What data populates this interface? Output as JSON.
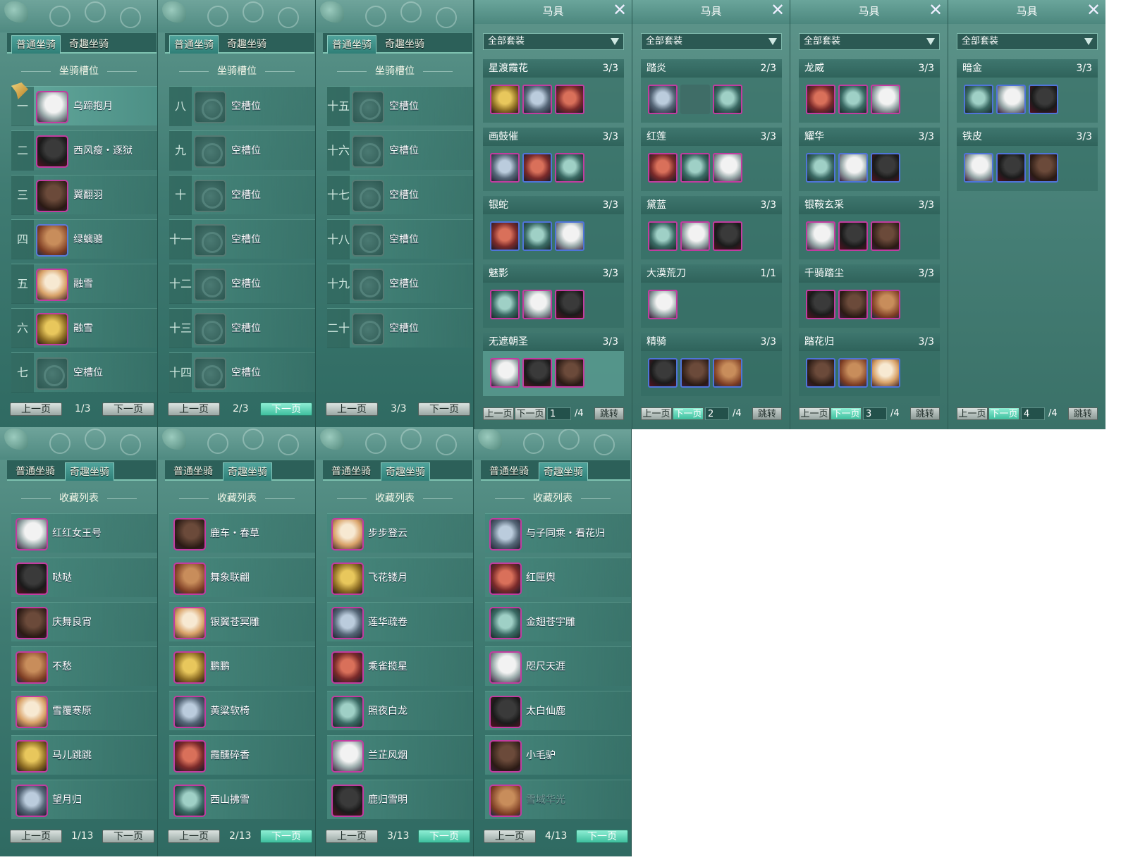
{
  "mounts": {
    "tab_normal": "普通坐骑",
    "tab_fun": "奇趣坐骑",
    "section_slots": "坐骑槽位",
    "section_collection": "收藏列表",
    "prev": "上一页",
    "next": "下一页",
    "slot_pages": [
      {
        "page": "1/3",
        "rows": [
          {
            "num": "一",
            "name": "乌蹄抱月",
            "icon": "white-horse-icon",
            "empty": false
          },
          {
            "num": "二",
            "name": "西风瘦・逐狱",
            "icon": "black-horse-icon",
            "empty": false
          },
          {
            "num": "三",
            "name": "翼翻羽",
            "icon": "dark-horse-icon",
            "empty": false
          },
          {
            "num": "四",
            "name": "绿螭骢",
            "icon": "chestnut-horse-icon",
            "empty": false
          },
          {
            "num": "五",
            "name": "融雪",
            "icon": "white-horse-icon",
            "empty": false
          },
          {
            "num": "六",
            "name": "融雪",
            "icon": "white-horse-icon",
            "empty": false
          },
          {
            "num": "七",
            "name": "空槽位",
            "icon": "empty-slot-icon",
            "empty": true
          }
        ]
      },
      {
        "page": "2/3",
        "rows": [
          {
            "num": "八",
            "name": "空槽位",
            "icon": "empty-slot-icon",
            "empty": true
          },
          {
            "num": "九",
            "name": "空槽位",
            "icon": "empty-slot-icon",
            "empty": true
          },
          {
            "num": "十",
            "name": "空槽位",
            "icon": "empty-slot-icon",
            "empty": true
          },
          {
            "num": "十一",
            "name": "空槽位",
            "icon": "empty-slot-icon",
            "empty": true
          },
          {
            "num": "十二",
            "name": "空槽位",
            "icon": "empty-slot-icon",
            "empty": true
          },
          {
            "num": "十三",
            "name": "空槽位",
            "icon": "empty-slot-icon",
            "empty": true
          },
          {
            "num": "十四",
            "name": "空槽位",
            "icon": "empty-slot-icon",
            "empty": true
          }
        ]
      },
      {
        "page": "3/3",
        "rows": [
          {
            "num": "十五",
            "name": "空槽位",
            "icon": "empty-slot-icon",
            "empty": true
          },
          {
            "num": "十六",
            "name": "空槽位",
            "icon": "empty-slot-icon",
            "empty": true
          },
          {
            "num": "十七",
            "name": "空槽位",
            "icon": "empty-slot-icon",
            "empty": true
          },
          {
            "num": "十八",
            "name": "空槽位",
            "icon": "empty-slot-icon",
            "empty": true
          },
          {
            "num": "十九",
            "name": "空槽位",
            "icon": "empty-slot-icon",
            "empty": true
          },
          {
            "num": "二十",
            "name": "空槽位",
            "icon": "empty-slot-icon",
            "empty": true
          }
        ]
      }
    ],
    "collection_pages": [
      {
        "page": "1/13",
        "rows": [
          "红红女王号",
          "哒哒",
          "庆舞良宵",
          "不愁",
          "雪覆寒原",
          "马儿跳跳",
          "望月归"
        ]
      },
      {
        "page": "2/13",
        "rows": [
          "鹿车・春草",
          "舞象联翩",
          "银翼苍冥雕",
          "鹏鹏",
          "黄粱软椅",
          "霞醺碎香",
          "西山拂雪"
        ]
      },
      {
        "page": "3/13",
        "rows": [
          "步步登云",
          "飞花镂月",
          "莲华疏卷",
          "乘雀揽星",
          "照夜白龙",
          "兰芷风烟",
          "鹿归雪明"
        ]
      },
      {
        "page": "4/13",
        "rows": [
          "与子同乘・看花归",
          "红匣舆",
          "金翅苍宇雕",
          "咫尺天涯",
          "太白仙鹿",
          "小毛驴",
          "雪域华光"
        ]
      }
    ]
  },
  "gear": {
    "title": "马具",
    "filter": "全部套装",
    "prev": "上一页",
    "next": "下一页",
    "total": "/4",
    "jump": "跳转",
    "pages": [
      {
        "page": "1",
        "sets": [
          {
            "name": "星渡霞花",
            "count": "3/3",
            "items": [
              "pink",
              "pink",
              "pink"
            ]
          },
          {
            "name": "画鼓催",
            "count": "3/3",
            "items": [
              "pink",
              "blue",
              "pink"
            ]
          },
          {
            "name": "银蛇",
            "count": "3/3",
            "items": [
              "blue",
              "blue",
              "blue"
            ]
          },
          {
            "name": "魅影",
            "count": "3/3",
            "items": [
              "pink",
              "pink",
              "pink"
            ]
          },
          {
            "name": "无遮朝圣",
            "count": "3/3",
            "items": [
              "pink",
              "pink",
              "pink"
            ]
          }
        ]
      },
      {
        "page": "2",
        "sets": [
          {
            "name": "踏炎",
            "count": "2/3",
            "items": [
              "pink",
              "empty",
              "pink"
            ]
          },
          {
            "name": "红莲",
            "count": "3/3",
            "items": [
              "pink",
              "pink",
              "pink"
            ]
          },
          {
            "name": "黛蓝",
            "count": "3/3",
            "items": [
              "pink",
              "pink",
              "pink"
            ]
          },
          {
            "name": "大漠荒刀",
            "count": "1/1",
            "items": [
              "pink"
            ]
          },
          {
            "name": "精骑",
            "count": "3/3",
            "items": [
              "blue",
              "blue",
              "blue"
            ]
          }
        ]
      },
      {
        "page": "3",
        "sets": [
          {
            "name": "龙威",
            "count": "3/3",
            "items": [
              "pink",
              "pink",
              "pink"
            ]
          },
          {
            "name": "耀华",
            "count": "3/3",
            "items": [
              "blue",
              "blue",
              "blue"
            ]
          },
          {
            "name": "银鞍玄采",
            "count": "3/3",
            "items": [
              "pink",
              "pink",
              "pink"
            ]
          },
          {
            "name": "千骑踏尘",
            "count": "3/3",
            "items": [
              "pink",
              "pink",
              "pink"
            ]
          },
          {
            "name": "踏花归",
            "count": "3/3",
            "items": [
              "blue",
              "blue",
              "blue"
            ]
          }
        ]
      },
      {
        "page": "4",
        "sets": [
          {
            "name": "暗金",
            "count": "3/3",
            "items": [
              "blue",
              "blue",
              "blue"
            ]
          },
          {
            "name": "铁皮",
            "count": "3/3",
            "items": [
              "blue",
              "blue",
              "blue"
            ]
          }
        ]
      }
    ]
  },
  "colors": {
    "rare_pink": "#c23ca0",
    "rare_blue": "#4f74d9",
    "button_green": "#3fbf9e"
  }
}
